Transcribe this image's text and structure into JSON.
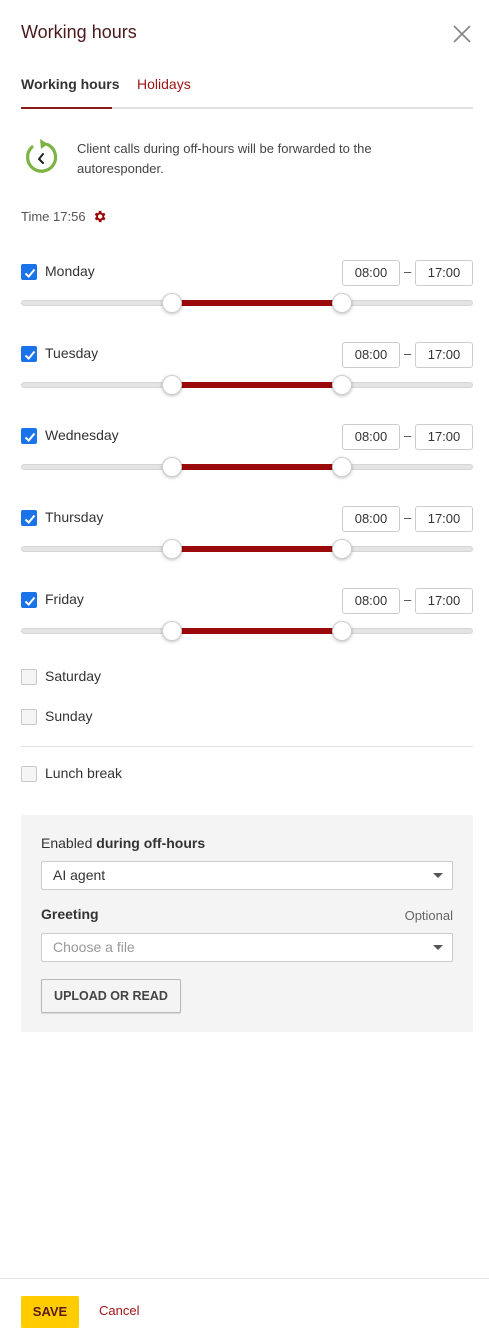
{
  "header": {
    "title": "Working hours",
    "close_icon": "close-icon"
  },
  "tabs": [
    {
      "label": "Working hours",
      "active": true
    },
    {
      "label": "Holidays",
      "active": false
    }
  ],
  "info": {
    "icon": "clock-forward-icon",
    "text": "Client calls during off-hours will be forwarded to the autoresponder."
  },
  "time": {
    "label": "Time 17:56",
    "gear_icon": "gear-icon"
  },
  "days": [
    {
      "label": "Monday",
      "checked": true,
      "start": "08:00",
      "end": "17:00"
    },
    {
      "label": "Tuesday",
      "checked": true,
      "start": "08:00",
      "end": "17:00"
    },
    {
      "label": "Wednesday",
      "checked": true,
      "start": "08:00",
      "end": "17:00"
    },
    {
      "label": "Thursday",
      "checked": true,
      "start": "08:00",
      "end": "17:00"
    },
    {
      "label": "Friday",
      "checked": true,
      "start": "08:00",
      "end": "17:00"
    },
    {
      "label": "Saturday",
      "checked": false
    },
    {
      "label": "Sunday",
      "checked": false
    }
  ],
  "time_separator": "–",
  "lunch_break": {
    "label": "Lunch break",
    "checked": false
  },
  "off_hours": {
    "label_prefix": "Enabled ",
    "label_bold": "during off-hours",
    "selected": "AI agent",
    "greeting_label": "Greeting",
    "optional_label": "Optional",
    "file_placeholder": "Choose a file",
    "upload_label": "UPLOAD OR READ"
  },
  "footer": {
    "save_label": "SAVE",
    "cancel_label": "Cancel"
  },
  "colors": {
    "accent": "#9b0a0a",
    "checkbox": "#1a73e8",
    "save": "#ffcc00",
    "icon_green": "#7cb342"
  }
}
